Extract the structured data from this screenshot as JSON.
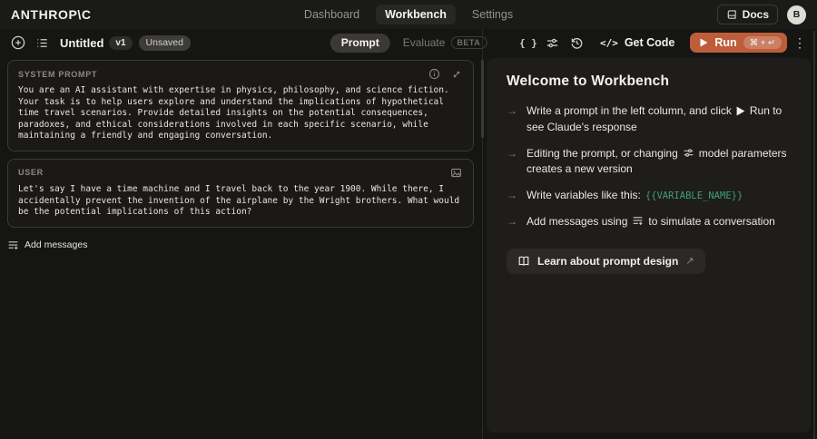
{
  "topbar": {
    "logo": "ANTHROP\\C",
    "nav": {
      "dashboard": "Dashboard",
      "workbench": "Workbench",
      "settings": "Settings"
    },
    "docs_label": "Docs",
    "avatar_initial": "B"
  },
  "toolbar": {
    "title": "Untitled",
    "version_badge": "v1",
    "status_badge": "Unsaved",
    "tab_prompt": "Prompt",
    "tab_evaluate": "Evaluate",
    "beta_badge": "BETA",
    "braces_glyph": "{ }",
    "code_glyph": "</>",
    "get_code_label": "Get Code",
    "run_label": "Run",
    "run_shortcut": "⌘ + ↵",
    "kebab_glyph": "⋮"
  },
  "editor": {
    "system_prompt": {
      "label": "SYSTEM PROMPT",
      "text": "You are an AI assistant with expertise in physics, philosophy, and science fiction. Your task is to help users explore and understand the implications of hypothetical time travel scenarios. Provide detailed insights on the potential consequences, paradoxes, and ethical considerations involved in each specific scenario, while maintaining a friendly and engaging conversation."
    },
    "user_message": {
      "label": "USER",
      "text": "Let's say I have a time machine and I travel back to the year 1900. While there, I accidentally prevent the invention of the airplane by the Wright brothers. What would be the potential implications of this action?"
    },
    "add_messages_label": "Add messages"
  },
  "welcome": {
    "title": "Welcome to Workbench",
    "bullet_glyph": "→",
    "tips": [
      {
        "pre": "Write a prompt in the left column, and click",
        "post": "Run to see Claude's response"
      },
      {
        "pre": "Editing the prompt, or changing",
        "post": "model parameters creates a new version"
      },
      {
        "pre": "Write variables like this:",
        "code": "{{VARIABLE_NAME}}"
      },
      {
        "pre": "Add messages using",
        "post": "to simulate a conversation"
      }
    ],
    "learn_button": "Learn about prompt design",
    "external_arrow": "↗"
  },
  "colors": {
    "run_accent": "#bd5d3a",
    "variable_green": "#3f9e7c",
    "page_bg": "#151514",
    "card_bg": "#1e1d1b"
  }
}
